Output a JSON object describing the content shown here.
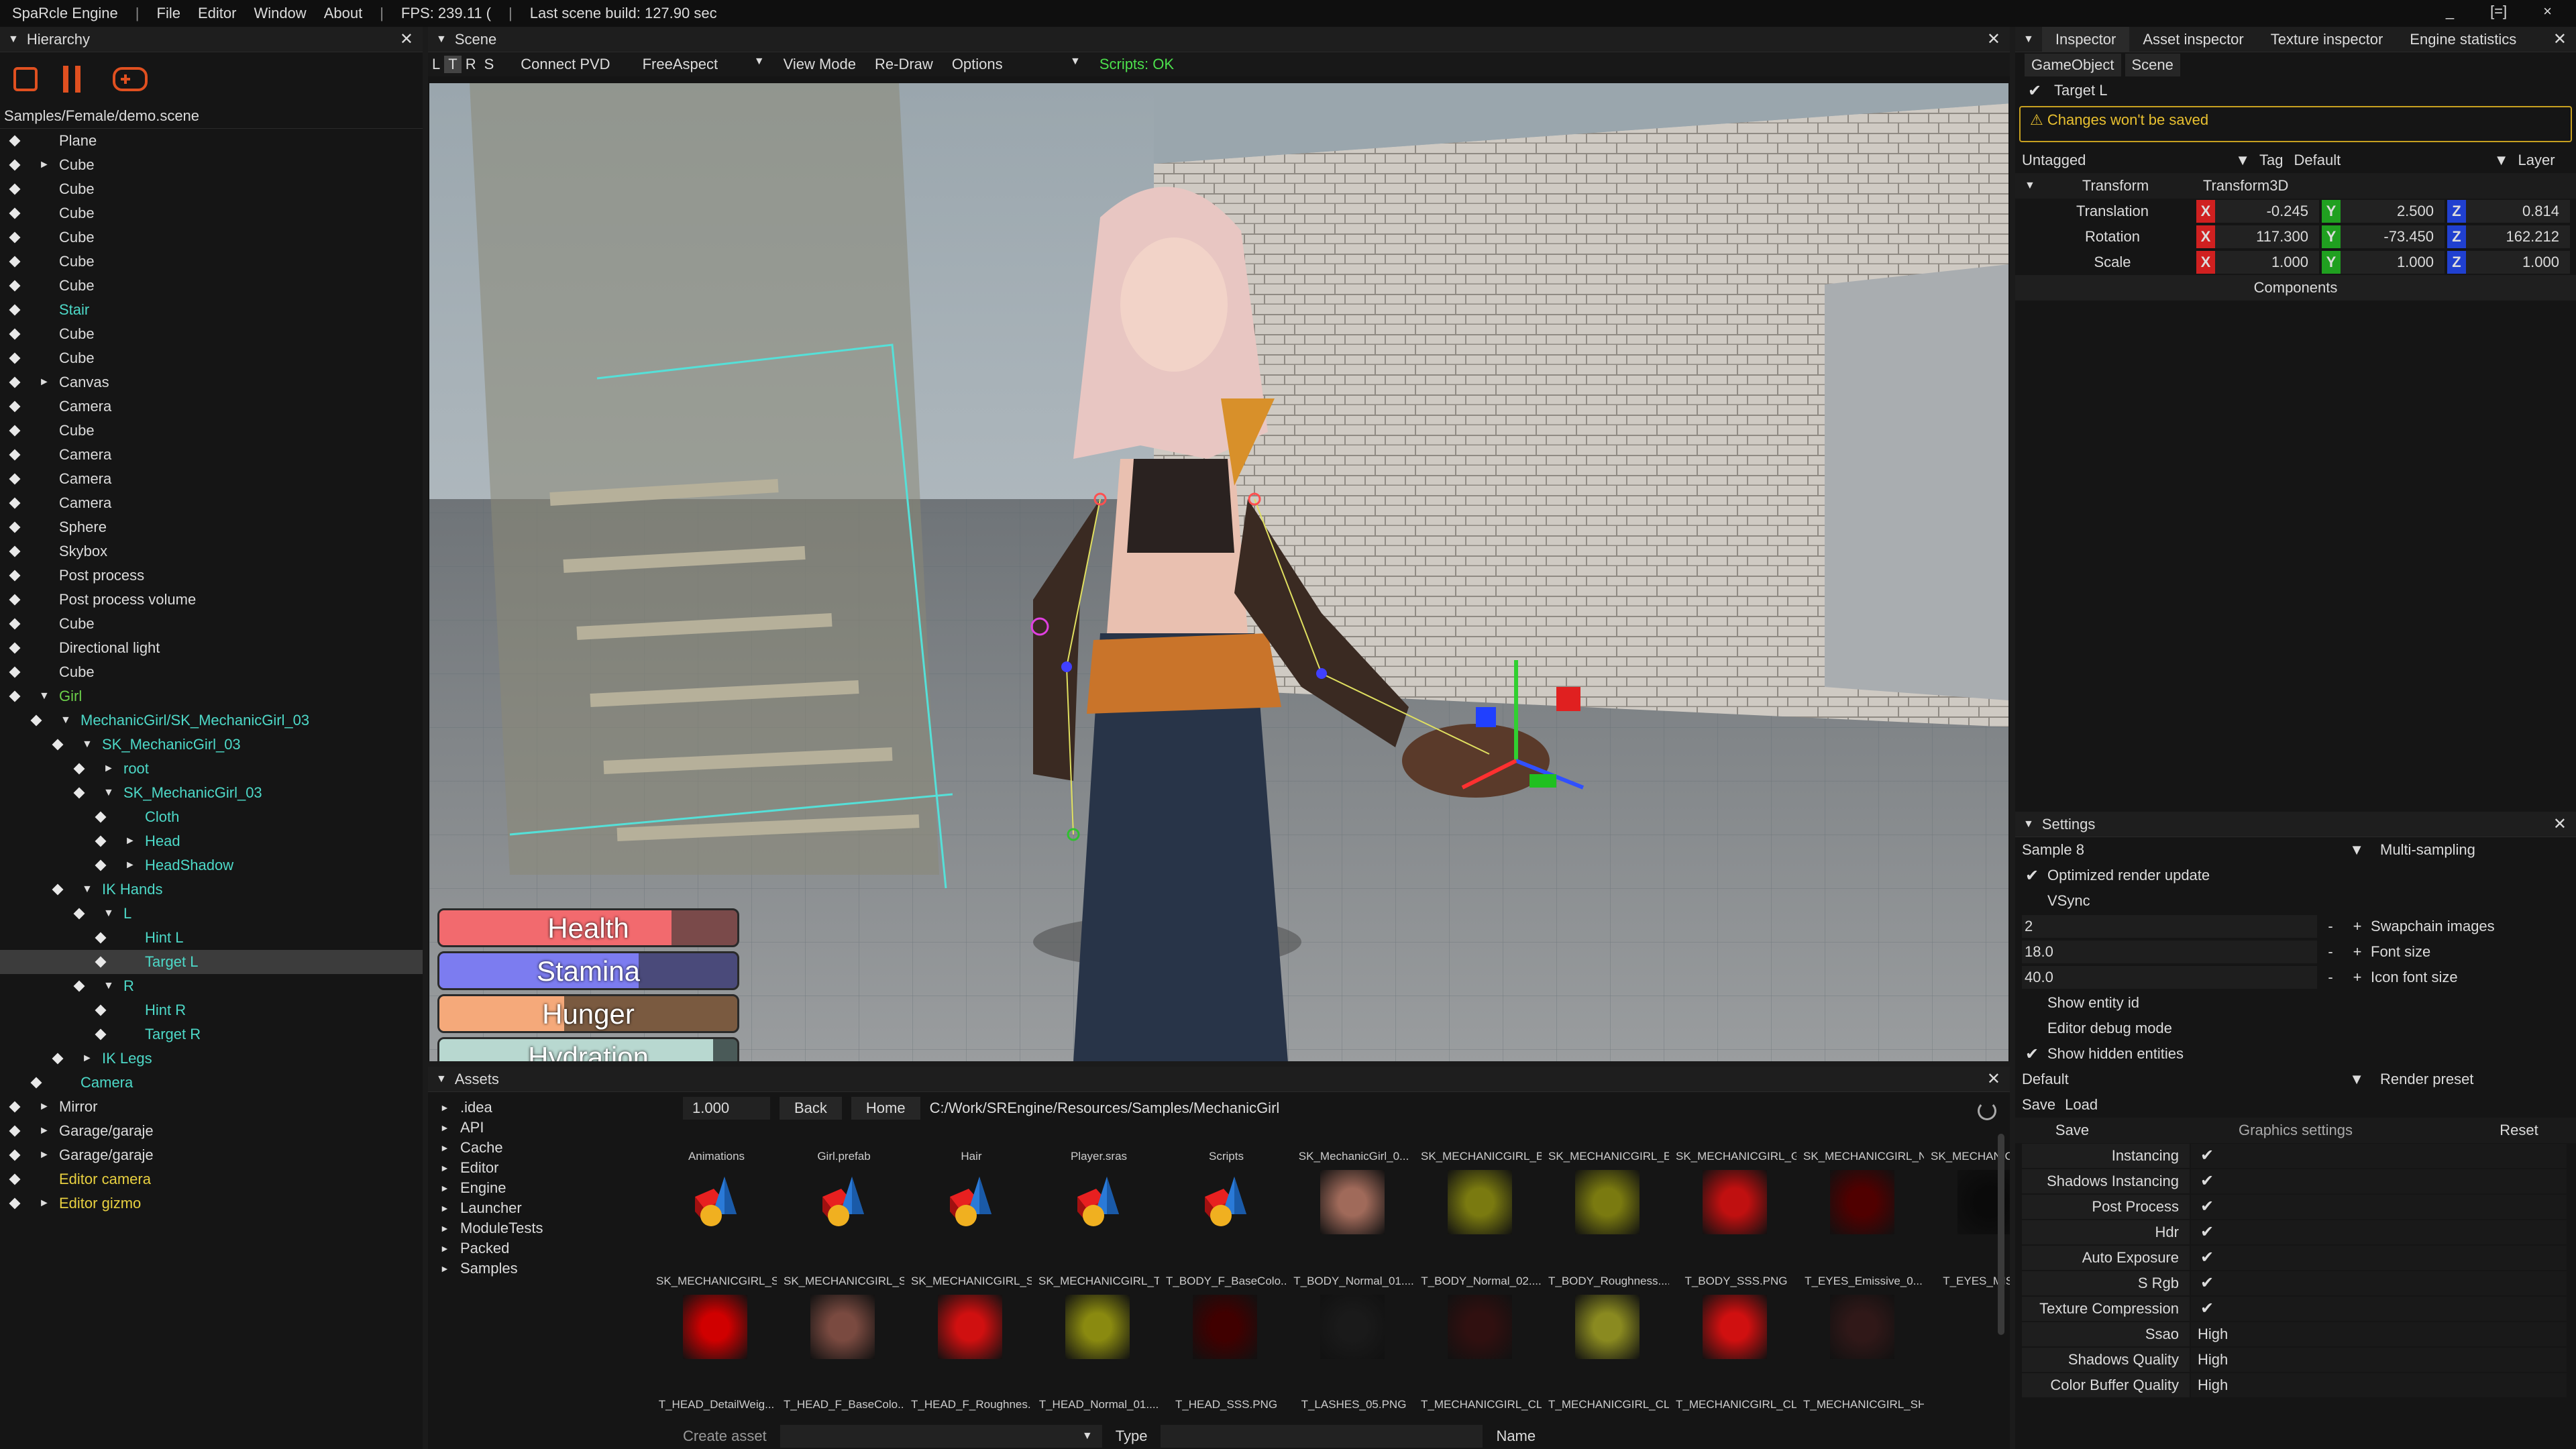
{
  "menubar": {
    "app": "SpaRcle Engine",
    "items": [
      "File",
      "Editor",
      "Window",
      "About"
    ],
    "fps": "FPS: 239.11 (",
    "last_build": "Last scene build: 127.90 sec",
    "controls": [
      "_",
      "[=]",
      "×"
    ]
  },
  "hierarchy": {
    "title": "Hierarchy",
    "path": "Samples/Female/demo.scene",
    "items": [
      {
        "label": "Plane",
        "depth": 0,
        "arrow": "",
        "color": "#dcdcdc"
      },
      {
        "label": "Cube",
        "depth": 0,
        "arrow": "►",
        "color": "#dcdcdc"
      },
      {
        "label": "Cube",
        "depth": 0,
        "arrow": "",
        "color": "#dcdcdc"
      },
      {
        "label": "Cube",
        "depth": 0,
        "arrow": "",
        "color": "#dcdcdc"
      },
      {
        "label": "Cube",
        "depth": 0,
        "arrow": "",
        "color": "#dcdcdc"
      },
      {
        "label": "Cube",
        "depth": 0,
        "arrow": "",
        "color": "#dcdcdc"
      },
      {
        "label": "Cube",
        "depth": 0,
        "arrow": "",
        "color": "#dcdcdc"
      },
      {
        "label": "Stair",
        "depth": 0,
        "arrow": "",
        "color": "#4dd9c8"
      },
      {
        "label": "Cube",
        "depth": 0,
        "arrow": "",
        "color": "#dcdcdc"
      },
      {
        "label": "Cube",
        "depth": 0,
        "arrow": "",
        "color": "#dcdcdc"
      },
      {
        "label": "Canvas",
        "depth": 0,
        "arrow": "►",
        "color": "#dcdcdc"
      },
      {
        "label": "Camera",
        "depth": 0,
        "arrow": "",
        "color": "#dcdcdc"
      },
      {
        "label": "Cube",
        "depth": 0,
        "arrow": "",
        "color": "#dcdcdc"
      },
      {
        "label": "Camera",
        "depth": 0,
        "arrow": "",
        "color": "#dcdcdc"
      },
      {
        "label": "Camera",
        "depth": 0,
        "arrow": "",
        "color": "#dcdcdc"
      },
      {
        "label": "Camera",
        "depth": 0,
        "arrow": "",
        "color": "#dcdcdc"
      },
      {
        "label": "Sphere",
        "depth": 0,
        "arrow": "",
        "color": "#dcdcdc"
      },
      {
        "label": "Skybox",
        "depth": 0,
        "arrow": "",
        "color": "#dcdcdc"
      },
      {
        "label": "Post process",
        "depth": 0,
        "arrow": "",
        "color": "#dcdcdc"
      },
      {
        "label": "Post process volume",
        "depth": 0,
        "arrow": "",
        "color": "#dcdcdc"
      },
      {
        "label": "Cube",
        "depth": 0,
        "arrow": "",
        "color": "#dcdcdc"
      },
      {
        "label": "Directional light",
        "depth": 0,
        "arrow": "",
        "color": "#dcdcdc"
      },
      {
        "label": "Cube",
        "depth": 0,
        "arrow": "",
        "color": "#dcdcdc"
      },
      {
        "label": "Girl",
        "depth": 0,
        "arrow": "▼",
        "color": "#6cd04a"
      },
      {
        "label": "MechanicGirl/SK_MechanicGirl_03",
        "depth": 1,
        "arrow": "▼",
        "color": "#4dd9c8"
      },
      {
        "label": "SK_MechanicGirl_03",
        "depth": 2,
        "arrow": "▼",
        "color": "#4dd9c8"
      },
      {
        "label": "root",
        "depth": 3,
        "arrow": "►",
        "color": "#4dd9c8"
      },
      {
        "label": "SK_MechanicGirl_03",
        "depth": 3,
        "arrow": "▼",
        "color": "#4dd9c8"
      },
      {
        "label": "Cloth",
        "depth": 4,
        "arrow": "",
        "color": "#4dd9c8"
      },
      {
        "label": "Head",
        "depth": 4,
        "arrow": "►",
        "color": "#4dd9c8"
      },
      {
        "label": "HeadShadow",
        "depth": 4,
        "arrow": "►",
        "color": "#4dd9c8"
      },
      {
        "label": "IK Hands",
        "depth": 2,
        "arrow": "▼",
        "color": "#4dd9c8"
      },
      {
        "label": "L",
        "depth": 3,
        "arrow": "▼",
        "color": "#4dd9c8"
      },
      {
        "label": "Hint L",
        "depth": 4,
        "arrow": "",
        "color": "#4dd9c8"
      },
      {
        "label": "Target L",
        "depth": 4,
        "arrow": "",
        "color": "#4dd9c8",
        "selected": true
      },
      {
        "label": "R",
        "depth": 3,
        "arrow": "▼",
        "color": "#4dd9c8"
      },
      {
        "label": "Hint R",
        "depth": 4,
        "arrow": "",
        "color": "#4dd9c8"
      },
      {
        "label": "Target R",
        "depth": 4,
        "arrow": "",
        "color": "#4dd9c8"
      },
      {
        "label": "IK Legs",
        "depth": 2,
        "arrow": "►",
        "color": "#4dd9c8"
      },
      {
        "label": "Camera",
        "depth": 1,
        "arrow": "",
        "color": "#4dd9c8"
      },
      {
        "label": "Mirror",
        "depth": 0,
        "arrow": "►",
        "color": "#dcdcdc"
      },
      {
        "label": "Garage/garaje",
        "depth": 0,
        "arrow": "►",
        "color": "#dcdcdc"
      },
      {
        "label": "Garage/garaje",
        "depth": 0,
        "arrow": "►",
        "color": "#dcdcdc"
      },
      {
        "label": "Editor camera",
        "depth": 0,
        "arrow": "",
        "color": "#e8d040"
      },
      {
        "label": "Editor gizmo",
        "depth": 0,
        "arrow": "►",
        "color": "#e8d040"
      }
    ]
  },
  "scene": {
    "title": "Scene",
    "modes": [
      "L",
      "T",
      "R",
      "S"
    ],
    "toolbar": [
      "Connect PVD",
      "FreeAspect",
      "View Mode",
      "Re-Draw",
      "Options"
    ],
    "scripts_status": "Scripts: OK",
    "bars": [
      {
        "label": "Health",
        "fill": 0.78,
        "color": "#f26a6e",
        "bg": "#7a4a4a"
      },
      {
        "label": "Stamina",
        "fill": 0.67,
        "color": "#7c7cf0",
        "bg": "#4a4a7a"
      },
      {
        "label": "Hunger",
        "fill": 0.42,
        "color": "#f5a97a",
        "bg": "#7a5a40"
      },
      {
        "label": "Hydration",
        "fill": 0.92,
        "color": "#b8d8d0",
        "bg": "#4a5a58"
      }
    ]
  },
  "assets": {
    "title": "Assets",
    "tree": [
      ".idea",
      "API",
      "Cache",
      "Editor",
      "Engine",
      "Launcher",
      "ModuleTests",
      "Packed",
      "Samples"
    ],
    "zoom": "1.000",
    "back": "Back",
    "home": "Home",
    "path": "C:/Work/SREngine/Resources/Samples/MechanicGirl",
    "row1": [
      {
        "label": "Animations",
        "kind": "folder"
      },
      {
        "label": "Girl.prefab",
        "kind": "prefab"
      },
      {
        "label": "Hair",
        "kind": "folder"
      },
      {
        "label": "Player.sras",
        "kind": "prefab"
      },
      {
        "label": "Scripts",
        "kind": "folder"
      },
      {
        "label": "SK_MechanicGirl_0...",
        "kind": "tex",
        "color": "#a06a5a"
      },
      {
        "label": "SK_MECHANICGIRL_B...",
        "kind": "tex",
        "color": "#7a7a10"
      },
      {
        "label": "SK_MECHANICGIRL_E...",
        "kind": "tex",
        "color": "#7a7a10"
      },
      {
        "label": "SK_MECHANICGIRL_G...",
        "kind": "tex",
        "color": "#c01010"
      },
      {
        "label": "SK_MECHANICGIRL_N...",
        "kind": "tex",
        "color": "#500000"
      },
      {
        "label": "SK_MECHANICGIRL_P...",
        "kind": "tex",
        "color": "#0a0a0a"
      },
      {
        "label": "",
        "kind": "tex",
        "color": "#300000"
      }
    ],
    "row2": [
      {
        "label": "SK_MECHANICGIRL_S...",
        "kind": "tex",
        "color": "#d00000"
      },
      {
        "label": "SK_MECHANICGIRL_S...",
        "kind": "tex",
        "color": "#7a4a40"
      },
      {
        "label": "SK_MECHANICGIRL_S...",
        "kind": "tex",
        "color": "#d01010"
      },
      {
        "label": "SK_MECHANICGIRL_T...",
        "kind": "tex",
        "color": "#8a8a10"
      },
      {
        "label": "T_BODY_F_BaseColo...",
        "kind": "tex",
        "color": "#400000"
      },
      {
        "label": "T_BODY_Normal_01....",
        "kind": "tex",
        "color": "#1a1a1a"
      },
      {
        "label": "T_BODY_Normal_02....",
        "kind": "tex",
        "color": "#301010"
      },
      {
        "label": "T_BODY_Roughness....",
        "kind": "tex",
        "color": "#8a8a20"
      },
      {
        "label": "T_BODY_SSS.PNG",
        "kind": "tex",
        "color": "#d01010"
      },
      {
        "label": "T_EYES_Emissive_0...",
        "kind": "tex",
        "color": "#301818"
      },
      {
        "label": "T_EYES_MIST_no",
        "kind": "none"
      }
    ],
    "row3": [
      "T_HEAD_DetailWeig...",
      "T_HEAD_F_BaseColo...",
      "T_HEAD_F_Roughnes...",
      "T_HEAD_Normal_01....",
      "T_HEAD_SSS.PNG",
      "T_LASHES_05.PNG",
      "T_MECHANICGIRL_CL...",
      "T_MECHANICGIRL_CL...",
      "T_MECHANICGIRL_CL...",
      "T_MECHANICGIRL_SH..."
    ],
    "create": "Create asset",
    "type": "Type",
    "name": "Name"
  },
  "inspector": {
    "tabs": [
      "Inspector",
      "Asset inspector",
      "Texture inspector",
      "Engine statistics"
    ],
    "sub_tabs": [
      "GameObject",
      "Scene"
    ],
    "object": "Target L",
    "warning": "⚠ Changes won't be saved",
    "tag_value": "Untagged",
    "tag_label": "Tag",
    "layer_value": "Default",
    "layer_label": "Layer",
    "transform": "Transform",
    "transform_type": "Transform3D",
    "rows": [
      {
        "label": "Translation",
        "x": "-0.245",
        "y": "2.500",
        "z": "0.814"
      },
      {
        "label": "Rotation",
        "x": "117.300",
        "y": "-73.450",
        "z": "162.212"
      },
      {
        "label": "Scale",
        "x": "1.000",
        "y": "1.000",
        "z": "1.000"
      }
    ],
    "components": "Components"
  },
  "settings": {
    "title": "Settings",
    "multisampling_value": "Sample 8",
    "multisampling_label": "Multi-sampling",
    "optimized": "Optimized render update",
    "vsync": "VSync",
    "swapchain_value": "2",
    "swapchain_label": "Swapchain images",
    "font_value": "18.0",
    "font_label": "Font size",
    "icon_value": "40.0",
    "icon_label": "Icon font size",
    "show_entity": "Show entity id",
    "debug_mode": "Editor debug mode",
    "show_hidden": "Show hidden entities",
    "preset_value": "Default",
    "preset_label": "Render preset",
    "save": "Save",
    "load": "Load",
    "gs_save": "Save",
    "gs_title": "Graphics settings",
    "gs_reset": "Reset",
    "graphics": [
      {
        "label": "Instancing",
        "value": "✔"
      },
      {
        "label": "Shadows Instancing",
        "value": "✔"
      },
      {
        "label": "Post Process",
        "value": "✔"
      },
      {
        "label": "Hdr",
        "value": "✔"
      },
      {
        "label": "Auto Exposure",
        "value": "✔"
      },
      {
        "label": "S Rgb",
        "value": "✔"
      },
      {
        "label": "Texture Compression",
        "value": "✔"
      },
      {
        "label": "Ssao",
        "value": "High"
      },
      {
        "label": "Shadows Quality",
        "value": "High"
      },
      {
        "label": "Color Buffer Quality",
        "value": "High"
      }
    ]
  }
}
